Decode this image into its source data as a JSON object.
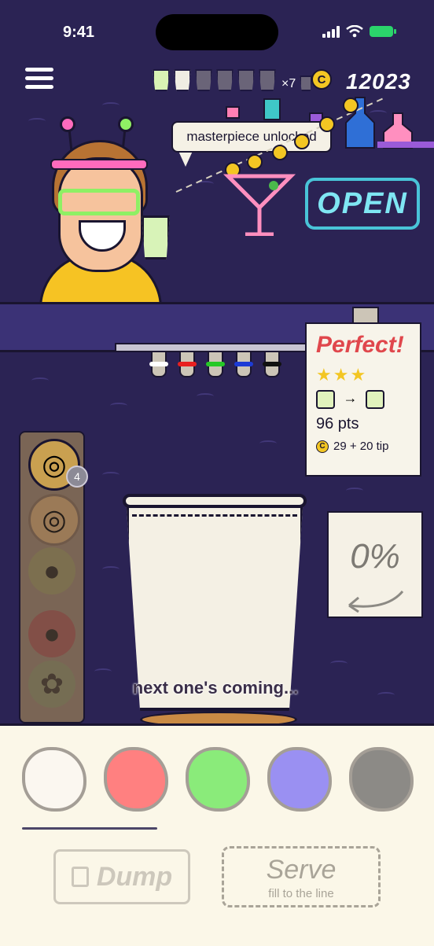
{
  "status": {
    "time": "9:41"
  },
  "top_bar": {
    "cups_multiplier": "×7",
    "coin_symbol": "C",
    "coin_count": "12023"
  },
  "bubble": {
    "text": "masterpiece unlocked"
  },
  "sign": {
    "text": "OPEN"
  },
  "receipt": {
    "title": "Perfect!",
    "stars": "★★★",
    "arrow": "→",
    "points": "96 pts",
    "tip": "29 + 20 tip"
  },
  "garnish": {
    "badge": "4"
  },
  "cup": {
    "status": "next one's coming..."
  },
  "fill_meter": {
    "percent": "0%"
  },
  "colors": [
    {
      "name": "white",
      "hex": "#fbf7f0"
    },
    {
      "name": "red",
      "hex": "#ff8080"
    },
    {
      "name": "green",
      "hex": "#8aeb7a"
    },
    {
      "name": "blue",
      "hex": "#9a90f2"
    },
    {
      "name": "black",
      "hex": "#8c8a86"
    }
  ],
  "actions": {
    "dump_label": "Dump",
    "serve_label": "Serve",
    "serve_hint": "fill to the line"
  }
}
